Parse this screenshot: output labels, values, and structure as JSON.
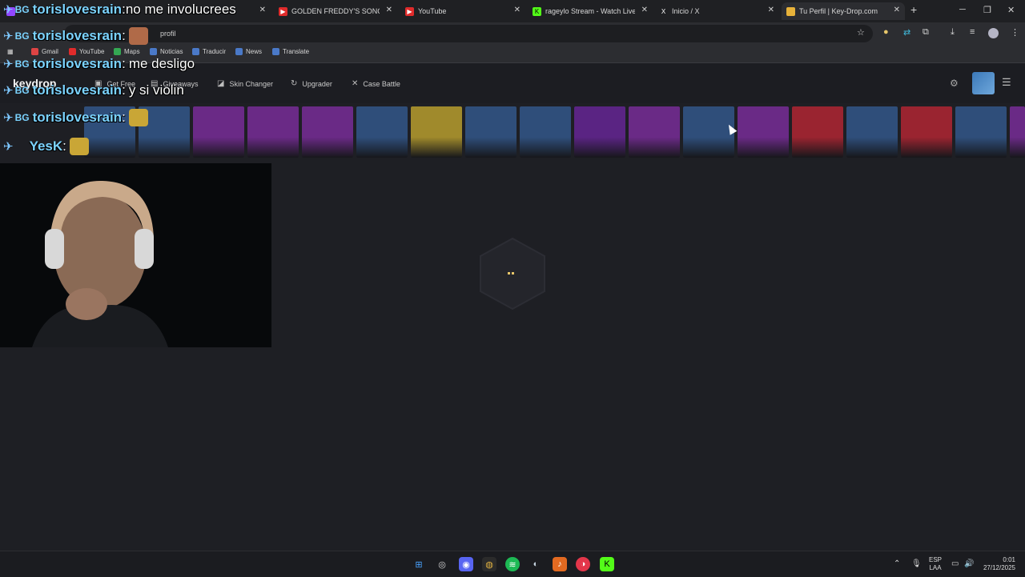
{
  "browser": {
    "tabs": [
      {
        "title": "",
        "icon": "twitch-icon"
      },
      {
        "title": "GOLDEN FREDDY'S SONG By I",
        "icon": "youtube-icon"
      },
      {
        "title": "YouTube",
        "icon": "youtube-icon"
      },
      {
        "title": "rageylo Stream - Watch Live on",
        "icon": "kick-icon"
      },
      {
        "title": "Inicio / X",
        "icon": "x-icon"
      },
      {
        "title": "Tu Perfil | Key-Drop.com",
        "icon": "keydrop-icon"
      }
    ],
    "close_glyph": "✕",
    "new_tab_glyph": "+",
    "url": "profil",
    "bookmarks": [
      "Gmail",
      "YouTube",
      "Maps",
      "Noticias",
      "Traducir",
      "News",
      "Translate"
    ]
  },
  "site": {
    "logo": "keydrop",
    "nav": [
      "Get Free",
      "Giveaways",
      "Skin Changer",
      "Upgrader",
      "Case Battle"
    ],
    "live_drop_colors": [
      "#2f4e7a",
      "#2f4e7a",
      "#6a2a86",
      "#6a2a86",
      "#6a2a86",
      "#2f4e7a",
      "#a08a2c",
      "#2f4e7a",
      "#2f4e7a",
      "#5a2483",
      "#6a2a86",
      "#2f4e7a",
      "#6a2a86",
      "#9a2430",
      "#2f4e7a",
      "#9a2430",
      "#2f4e7a",
      "#6a2a86"
    ]
  },
  "chat": [
    {
      "user": "torislovesrain",
      "message": "no me involucrees"
    },
    {
      "user": "torislovesrain",
      "message": ""
    },
    {
      "user": "torislovesrain",
      "message": "me desligo"
    },
    {
      "user": "torislovesrain",
      "message": "y si violin"
    },
    {
      "user": "torislovesrain",
      "message": ""
    },
    {
      "user": "YesK",
      "message": ""
    }
  ],
  "chat_separator": ":",
  "taskbar": {
    "language": "ESP",
    "layout": "LAA",
    "time": "0:01",
    "date": "27/12/2025"
  }
}
